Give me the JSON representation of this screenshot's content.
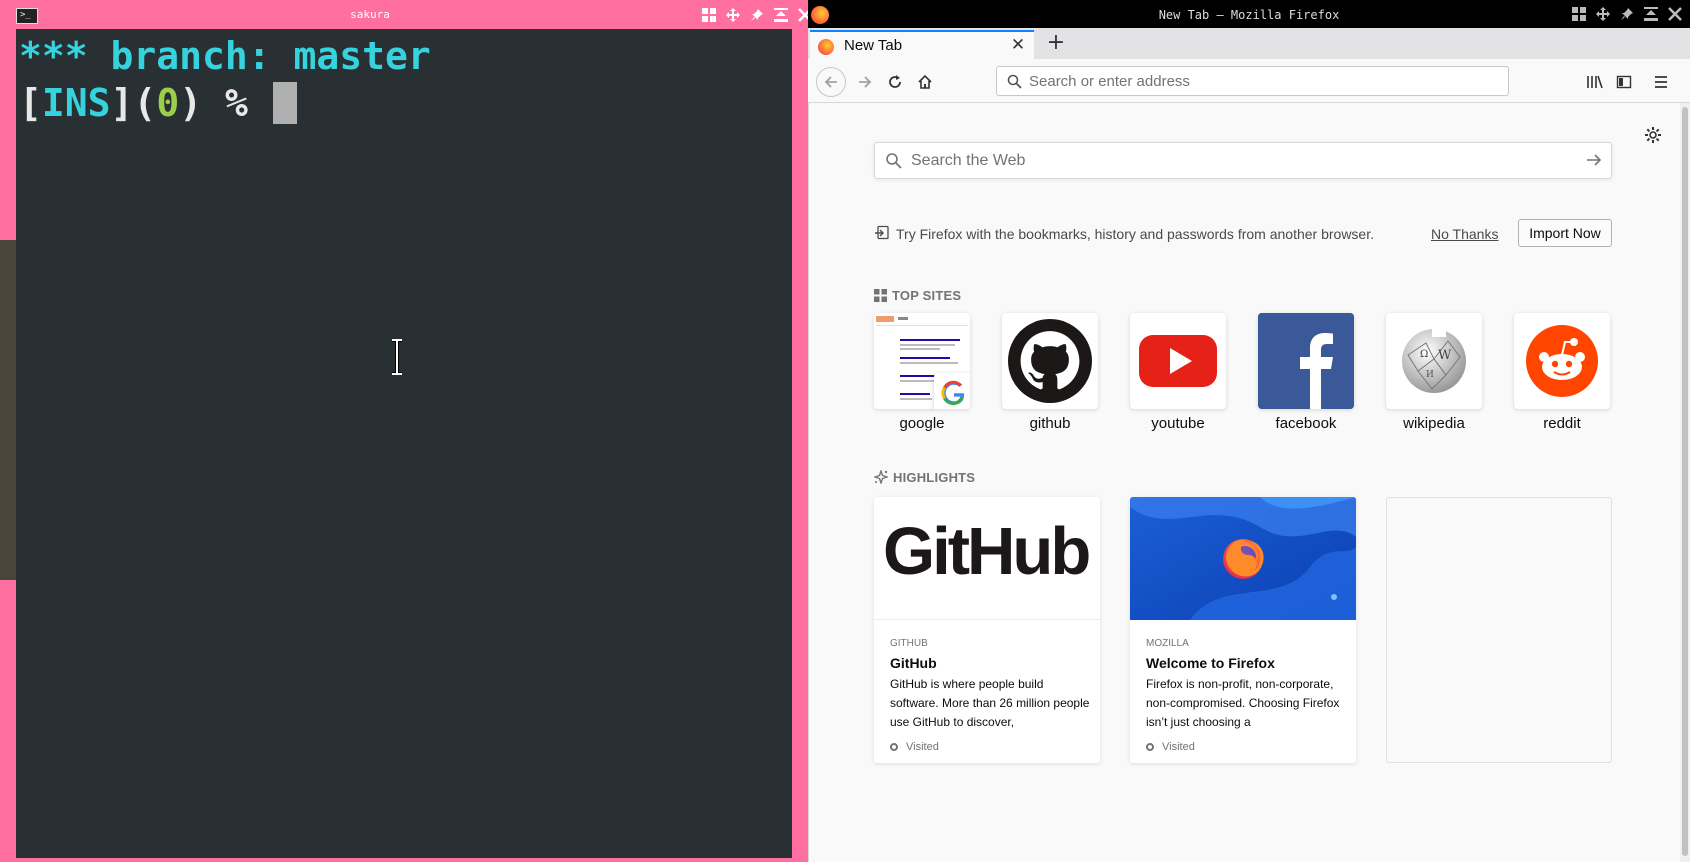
{
  "terminal": {
    "title": "sakura",
    "icon": "terminal-icon",
    "line1": {
      "text": "*** branch: master"
    },
    "line2": {
      "bracket_open": "[",
      "mode": "INS",
      "bracket_close": "]",
      "paren_open": "(",
      "code": "0",
      "paren_close": ")",
      "prompt": " % "
    },
    "colors": {
      "background": "#283033",
      "border": "#ff6fa0",
      "cyan": "#36d3df",
      "green": "#9acf4b"
    }
  },
  "firefox": {
    "window_title": "New Tab – Mozilla Firefox",
    "tab": {
      "label": "New Tab"
    },
    "urlbar": {
      "placeholder": "Search or enter address"
    },
    "search": {
      "placeholder": "Search the Web"
    },
    "import": {
      "text": "Try Firefox with the bookmarks, history and passwords from another browser.",
      "no_thanks": "No Thanks",
      "import_now": "Import Now"
    },
    "top_sites": {
      "heading": "TOP SITES",
      "sites": [
        {
          "label": "google",
          "icon": "google-icon"
        },
        {
          "label": "github",
          "icon": "github-icon"
        },
        {
          "label": "youtube",
          "icon": "youtube-icon"
        },
        {
          "label": "facebook",
          "icon": "facebook-icon"
        },
        {
          "label": "wikipedia",
          "icon": "wikipedia-icon"
        },
        {
          "label": "reddit",
          "icon": "reddit-icon"
        }
      ]
    },
    "highlights": {
      "heading": "HIGHLIGHTS",
      "cards": [
        {
          "image_text": "GitHub",
          "source": "GITHUB",
          "title": "GitHub",
          "description": "GitHub is where people build software. More than 26 million people use GitHub to discover,",
          "context": "Visited"
        },
        {
          "image_text": "",
          "source": "MOZILLA",
          "title": "Welcome to Firefox",
          "description": "Firefox is non-profit, non-corporate, non-compromised. Choosing Firefox isn’t just choosing a",
          "context": "Visited"
        }
      ]
    },
    "colors": {
      "accent": "#0a84ff",
      "page_bg": "#f9f9fa"
    }
  }
}
